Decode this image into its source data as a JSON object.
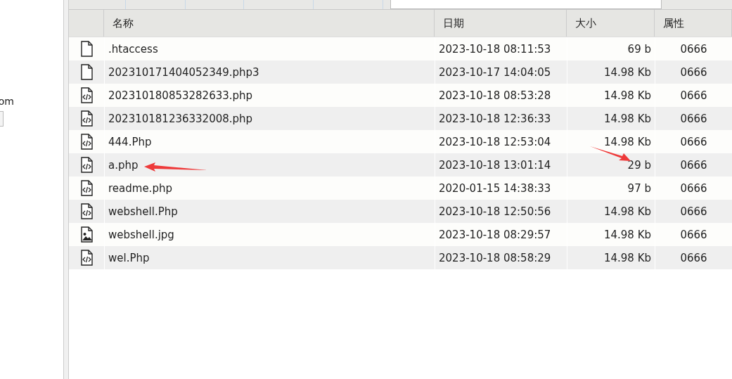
{
  "left_panel": {
    "label": "om"
  },
  "table": {
    "columns": [
      {
        "label": "名称"
      },
      {
        "label": "日期"
      },
      {
        "label": "大小"
      },
      {
        "label": "属性"
      }
    ],
    "rows": [
      {
        "kind": "blank",
        "name": ".htaccess",
        "date": "2023-10-18 08:11:53",
        "size": "69 b",
        "attr": "0666"
      },
      {
        "kind": "blank",
        "name": "202310171404052349.php3",
        "date": "2023-10-17 14:04:05",
        "size": "14.98 Kb",
        "attr": "0666"
      },
      {
        "kind": "code",
        "name": "202310180853282633.php",
        "date": "2023-10-18 08:53:28",
        "size": "14.98 Kb",
        "attr": "0666"
      },
      {
        "kind": "code",
        "name": "202310181236332008.php",
        "date": "2023-10-18 12:36:33",
        "size": "14.98 Kb",
        "attr": "0666"
      },
      {
        "kind": "code",
        "name": "444.Php",
        "date": "2023-10-18 12:53:04",
        "size": "14.98 Kb",
        "attr": "0666"
      },
      {
        "kind": "code",
        "name": "a.php",
        "date": "2023-10-18 13:01:14",
        "size": "29 b",
        "attr": "0666"
      },
      {
        "kind": "code",
        "name": "readme.php",
        "date": "2020-01-15 14:38:33",
        "size": "97 b",
        "attr": "0666"
      },
      {
        "kind": "code",
        "name": "webshell.Php",
        "date": "2023-10-18 12:50:56",
        "size": "14.98 Kb",
        "attr": "0666"
      },
      {
        "kind": "image",
        "name": "webshell.jpg",
        "date": "2023-10-18 08:29:57",
        "size": "14.98 Kb",
        "attr": "0666"
      },
      {
        "kind": "code",
        "name": "wel.Php",
        "date": "2023-10-18 08:58:29",
        "size": "14.98 Kb",
        "attr": "0666"
      }
    ]
  }
}
